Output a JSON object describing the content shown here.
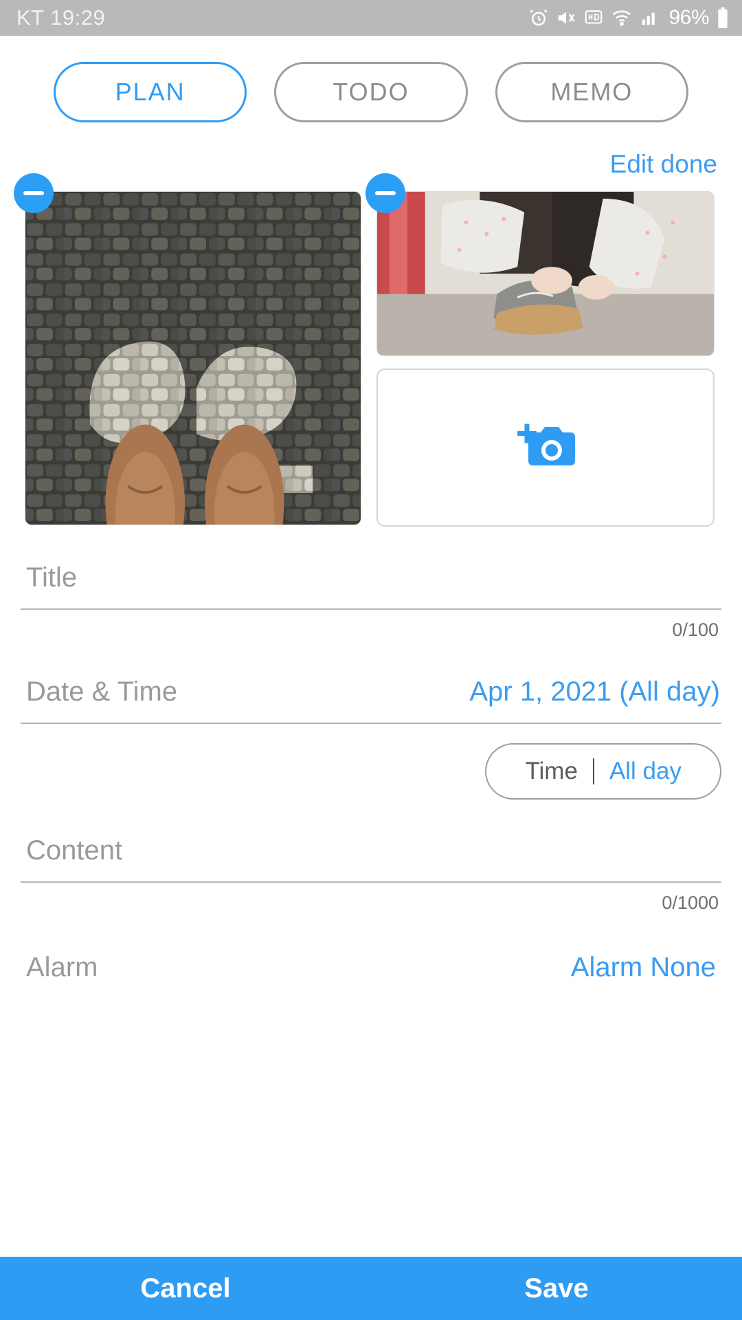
{
  "status_bar": {
    "carrier_time": "KT 19:29",
    "battery": "96%",
    "icons": [
      "alarm-icon",
      "mute-vibrate-icon",
      "hd-icon",
      "wifi-icon",
      "signal-icon",
      "battery-icon"
    ]
  },
  "tabs": [
    {
      "label": "PLAN",
      "active": true
    },
    {
      "label": "TODO",
      "active": false
    },
    {
      "label": "MEMO",
      "active": false
    }
  ],
  "editor": {
    "edit_done_label": "Edit done",
    "attachments": [
      {
        "alt": "photo-shoes-on-cobblestone",
        "remove_label": "remove"
      },
      {
        "alt": "photo-child-tying-shoes",
        "remove_label": "remove"
      }
    ],
    "add_photo_label": "add-photo"
  },
  "fields": {
    "title": {
      "label": "Title",
      "value": "",
      "placeholder": "Title",
      "counter": "0/100"
    },
    "datetime": {
      "label": "Date & Time",
      "value": "Apr 1, 2021  (All day)",
      "toggle": {
        "options": [
          "Time",
          "All day"
        ],
        "selected": "All day"
      }
    },
    "content": {
      "label": "Content",
      "value": "",
      "placeholder": "Content",
      "counter": "0/1000"
    },
    "alarm": {
      "label": "Alarm",
      "value": "Alarm None"
    }
  },
  "bottom_bar": {
    "cancel_label": "Cancel",
    "save_label": "Save"
  },
  "colors": {
    "accent": "#2f9cf4",
    "link": "#3b9cf0",
    "muted": "#9a9a9a",
    "status_bg": "#b9b9b9"
  }
}
